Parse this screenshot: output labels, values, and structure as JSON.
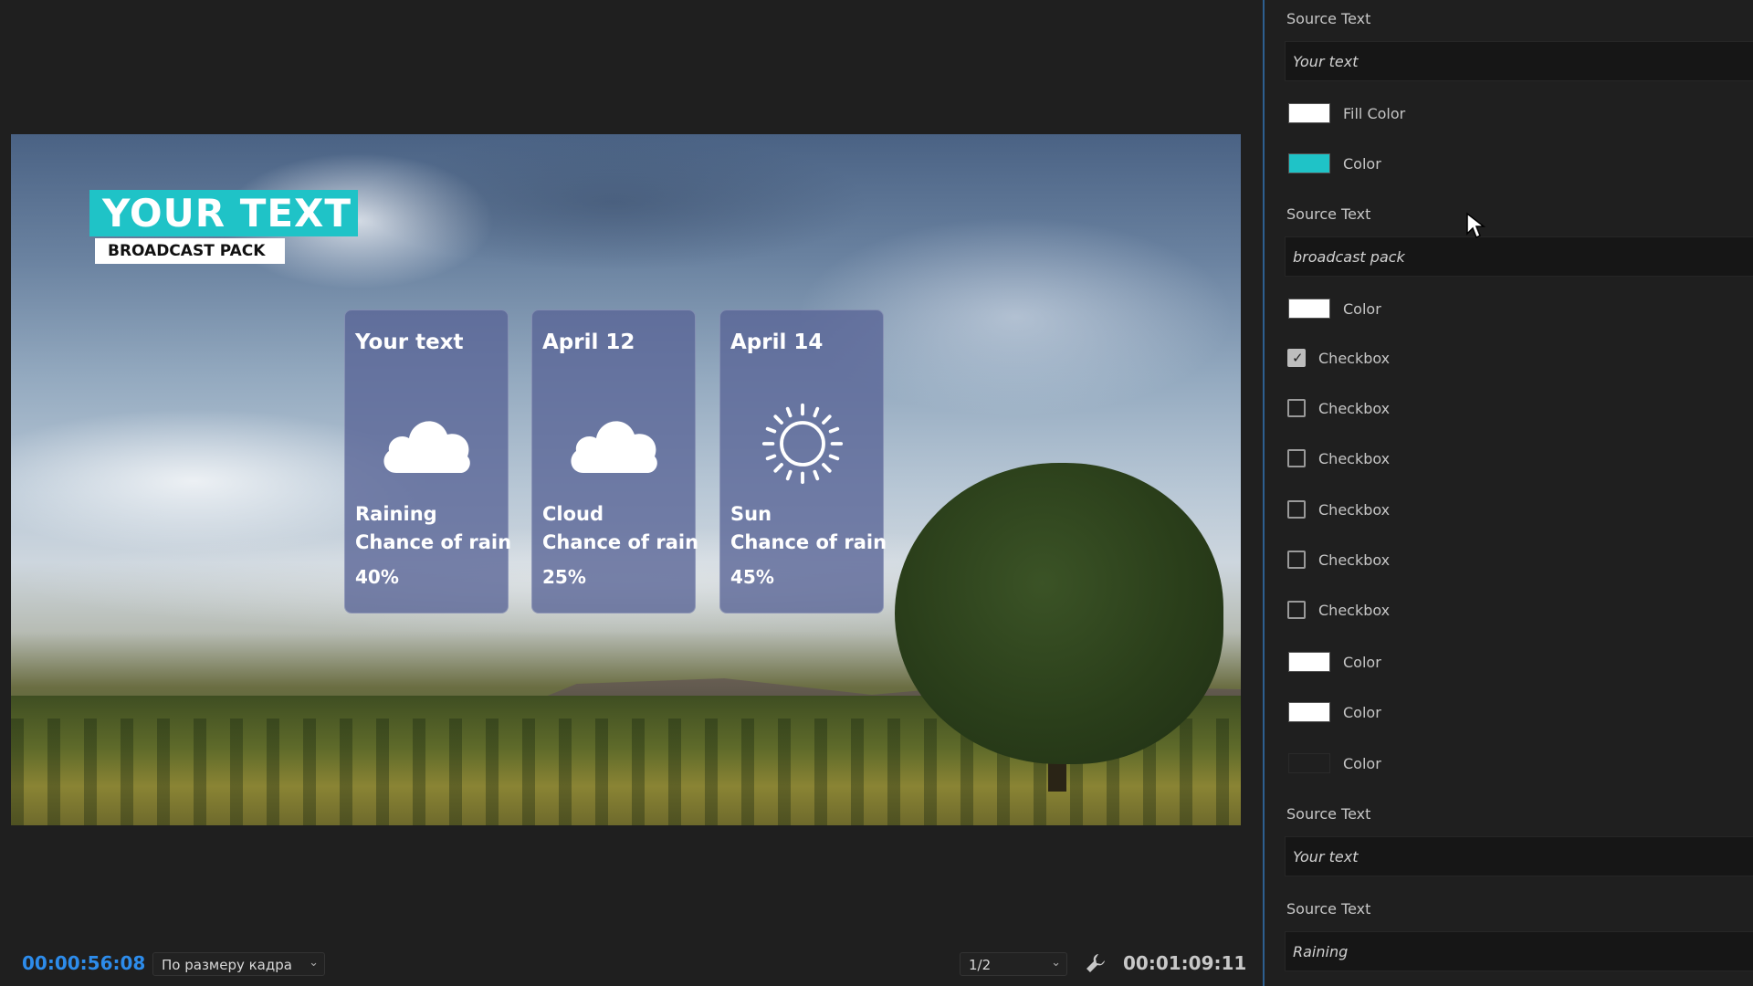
{
  "monitor": {
    "title": "YOUR TEXT",
    "subtitle": "BROADCAST PACK",
    "title_color": "#1fc3c7",
    "cards": [
      {
        "date": "Your text",
        "icon": "cloud-icon",
        "condition": "Raining",
        "chance_label": "Chance of rain",
        "chance": "40%"
      },
      {
        "date": "April 12",
        "icon": "cloud-icon",
        "condition": "Cloud",
        "chance_label": "Chance of rain",
        "chance": "25%"
      },
      {
        "date": "April 14",
        "icon": "sun-icon",
        "condition": "Sun",
        "chance_label": "Chance of rain",
        "chance": "45%"
      }
    ],
    "timecode_current": "00:00:56:08",
    "zoom": "По размеру кадра",
    "resolution": "1/2",
    "timecode_duration": "00:01:09:11",
    "wrench_icon": "wrench-icon"
  },
  "panel": {
    "source1_label": "Source Text",
    "source1_value": "Your text",
    "fill_color_label": "Fill Color",
    "fill_color": "#ffffff",
    "color1_label": "Color",
    "color1": "#1fc3c7",
    "source2_label": "Source Text",
    "source2_value": "broadcast pack",
    "color2_label": "Color",
    "color2": "#ffffff",
    "checkboxes": [
      {
        "label": "Checkbox",
        "checked": true
      },
      {
        "label": "Checkbox",
        "checked": false
      },
      {
        "label": "Checkbox",
        "checked": false
      },
      {
        "label": "Checkbox",
        "checked": false
      },
      {
        "label": "Checkbox",
        "checked": false
      },
      {
        "label": "Checkbox",
        "checked": false
      }
    ],
    "color3_label": "Color",
    "color3": "#ffffff",
    "color4_label": "Color",
    "color4": "#ffffff",
    "color5_label": "Color",
    "color5": "#1f1f1f",
    "source3_label": "Source Text",
    "source3_value": "Your text",
    "source4_label": "Source Text",
    "source4_value": "Raining"
  }
}
